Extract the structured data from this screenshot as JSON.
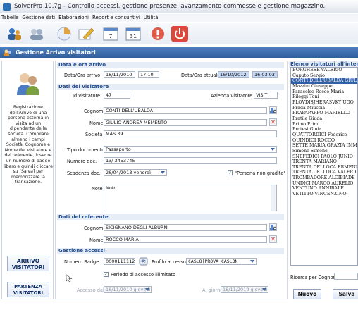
{
  "app": {
    "title": "SolverPro 10.7g - Controllo accessi, gestione presenze, avanzamento commesse e gestione magazzino."
  },
  "menu": [
    "Tabelle",
    "Gestione dati",
    "Elaborazioni",
    "Report e consuntivi",
    "Utilità"
  ],
  "toolbar": {
    "cal1": "7",
    "cal2": "31"
  },
  "window": {
    "title": "Gestione Arrivo visitatori"
  },
  "left": {
    "help": "Registrazione dell'Arrivo di una persona esterna in visita ad un dipendente della società. Compilare almeno i campi Società, Cognome e Nome del visitatore e del referente, inserire un numero di badge libero e quindi cliccare su [Salva] per memorizzare la transazione.",
    "arrivo": "ARRIVO VISITATORI",
    "partenza": "PARTENZA VISITATORI"
  },
  "arrival": {
    "section": "Data e ora arrivo",
    "datetime_label": "Data/Ora arrivo",
    "date": "18/11/2010",
    "time": "17.10",
    "current_label": "Data/Ora attuali",
    "current_date": "16/10/2012",
    "current_time": "16.03.03"
  },
  "visitor": {
    "section": "Dati del visitatore",
    "id_label": "Id visitatore",
    "id": "47",
    "company_label": "Azienda visitatore",
    "company": "VISIT",
    "surname_label": "Cognome",
    "surname": "CONTI DELL'UBALDA",
    "name_label": "Nome",
    "name": "GIULIO ANDREA MEMENTO",
    "societa_label": "Società",
    "societa": "MAS 39",
    "doctype_label": "Tipo documento",
    "doctype": "Passaporto",
    "docnum_label": "Numero doc.",
    "docnum": "13/ 3453745",
    "expiry_label": "Scadenza doc.",
    "expiry": "26/04/2013  venerdì",
    "non_grata_label": "\"Persona non gradita\"",
    "notes_label": "Note",
    "notes": "Noto"
  },
  "referent": {
    "section": "Dati del referente",
    "surname_label": "Cognome",
    "surname": "SICIGNANO DEGLI ALBURNI",
    "name_label": "Nome",
    "name": "ROCCO MARIA"
  },
  "access": {
    "section": "Gestione accessi",
    "badge_label": "Numero Badge",
    "badge": "0000111112",
    "profile_label": "Profilo accesso",
    "profile": "CASLO|PROVA CASLON",
    "unlimited_label": "Periodo di accesso illimitato",
    "from_label": "Accesso dal",
    "from": "18/11/2010  giovedì",
    "to_label": "Al giorno",
    "to": "18/11/2010  giovedì"
  },
  "visitors": {
    "header": "Elenco visitatori all'interno -",
    "items": [
      "BORGHESE VALERIO",
      "Caputo Sergio",
      "CONTI DELL'UBALDA GIULI",
      "Mazzini Giuseppe",
      "Paracelso Rocco Maria",
      "Pileggi Toni",
      "PLOVDISJHERASVKY UGO",
      "Prada Miuccia",
      "PRAPAPAPPO MARIELLO",
      "Pratile Giuda",
      "Primo Primi",
      "Protesi Gioia",
      "QUATTORDICI Federico",
      "QUINDICI ROCCO",
      "SETTE MARIA GRAZIA IMMA",
      "Simone Simone",
      "SNEFEDICI PAOLO JUNIO",
      "TRENTA MARIANO",
      "TRENTA DELLOCA ERMENEGI",
      "TRENTA DELLOCA VALERIO",
      "TROMBADORE ALCIBIADE",
      "UNDICI MARCO AURELIO",
      "VENTUNO ANNIBALE",
      "VETITTO VINCENZINO"
    ],
    "selected": 2,
    "search_label": "Ricerca per Cognome",
    "search_value": ""
  },
  "buttons": {
    "nuovo": "Nuovo",
    "salva": "Salva"
  }
}
